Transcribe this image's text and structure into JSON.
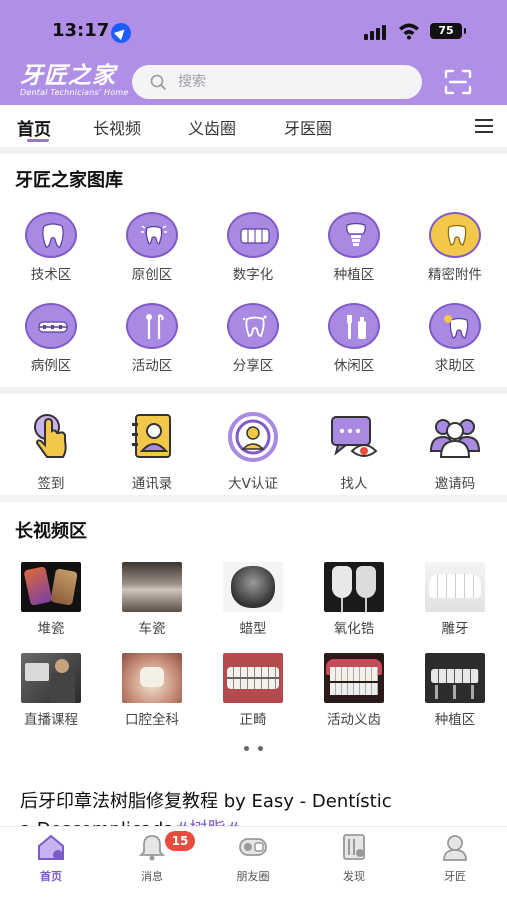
{
  "status": {
    "time": "13:17",
    "battery": "75"
  },
  "header": {
    "logo_main": "牙匠之家",
    "logo_sub": "Dental Technicians' Home",
    "search_placeholder": "搜索"
  },
  "tabs": [
    {
      "label": "首页",
      "active": true
    },
    {
      "label": "长视频"
    },
    {
      "label": "义齿圈"
    },
    {
      "label": "牙医圈"
    }
  ],
  "gallery": {
    "title": "牙匠之家图库",
    "items": [
      {
        "label": "技术区",
        "icon": "tooth-icon"
      },
      {
        "label": "原创区",
        "icon": "tooth-spark-icon"
      },
      {
        "label": "数字化",
        "icon": "teeth-row-icon"
      },
      {
        "label": "种植区",
        "icon": "implant-icon"
      },
      {
        "label": "精密附件",
        "icon": "gold-tooth-icon"
      },
      {
        "label": "病例区",
        "icon": "braces-icon"
      },
      {
        "label": "活动区",
        "icon": "dental-tools-icon"
      },
      {
        "label": "分享区",
        "icon": "tooth-share-icon"
      },
      {
        "label": "休闲区",
        "icon": "toothbrush-icon"
      },
      {
        "label": "求助区",
        "icon": "sparkle-tooth-icon"
      }
    ]
  },
  "tools": [
    {
      "label": "签到",
      "icon": "tap-icon"
    },
    {
      "label": "通讯录",
      "icon": "contacts-icon"
    },
    {
      "label": "大V认证",
      "icon": "verified-icon"
    },
    {
      "label": "找人",
      "icon": "find-people-icon"
    },
    {
      "label": "邀请码",
      "icon": "invite-icon"
    }
  ],
  "videos": {
    "title": "长视频区",
    "items": [
      {
        "label": "堆瓷"
      },
      {
        "label": "车瓷"
      },
      {
        "label": "蜡型"
      },
      {
        "label": "氧化锆"
      },
      {
        "label": "雕牙"
      },
      {
        "label": "直播课程"
      },
      {
        "label": "口腔全科"
      },
      {
        "label": "正畸"
      },
      {
        "label": "活动义齿"
      },
      {
        "label": "种植区"
      }
    ]
  },
  "article": {
    "line1": "后牙印章法树脂修复教程 by Easy - Dentístic",
    "line2_text": "a Descomplicada",
    "line2_tag": "#树脂#"
  },
  "bottom_nav": {
    "items": [
      {
        "label": "首页",
        "active": true
      },
      {
        "label": "消息"
      },
      {
        "label": "朋友圈"
      },
      {
        "label": "发现"
      },
      {
        "label": "牙匠"
      }
    ],
    "message_badge": "15"
  },
  "colors": {
    "brand": "#b08fe7",
    "accent": "#7c5bc4",
    "badge": "#e84c3d"
  }
}
